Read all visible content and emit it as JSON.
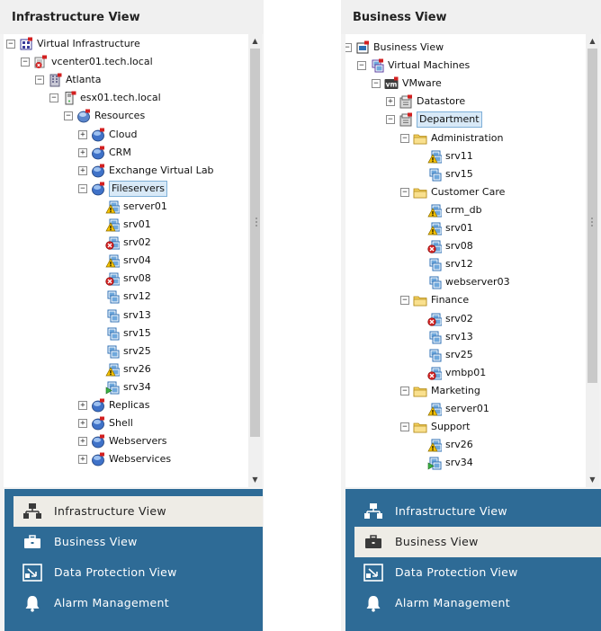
{
  "left": {
    "title": "Infrastructure View",
    "tree": [
      {
        "d": 0,
        "e": "-",
        "i": "vi-icon",
        "l": "Virtual Infrastructure"
      },
      {
        "d": 1,
        "e": "-",
        "i": "vcenter-icon",
        "l": "vcenter01.tech.local"
      },
      {
        "d": 2,
        "e": "-",
        "i": "datacenter-icon",
        "l": "Atlanta"
      },
      {
        "d": 3,
        "e": "-",
        "i": "host-icon",
        "l": "esx01.tech.local"
      },
      {
        "d": 4,
        "e": "-",
        "i": "resources-icon",
        "l": "Resources"
      },
      {
        "d": 5,
        "e": "+",
        "i": "pool-icon",
        "l": "Cloud"
      },
      {
        "d": 5,
        "e": "+",
        "i": "pool-icon",
        "l": "CRM"
      },
      {
        "d": 5,
        "e": "+",
        "i": "pool-icon",
        "l": "Exchange Virtual Lab"
      },
      {
        "d": 5,
        "e": "-",
        "i": "pool-icon",
        "l": "Fileservers",
        "sel": true
      },
      {
        "d": 6,
        "e": "",
        "i": "vm-warning-icon",
        "l": "server01"
      },
      {
        "d": 6,
        "e": "",
        "i": "vm-warning-icon",
        "l": "srv01"
      },
      {
        "d": 6,
        "e": "",
        "i": "vm-error-icon",
        "l": "srv02"
      },
      {
        "d": 6,
        "e": "",
        "i": "vm-warning-icon",
        "l": "srv04"
      },
      {
        "d": 6,
        "e": "",
        "i": "vm-error-icon",
        "l": "srv08"
      },
      {
        "d": 6,
        "e": "",
        "i": "vm-icon",
        "l": "srv12"
      },
      {
        "d": 6,
        "e": "",
        "i": "vm-icon",
        "l": "srv13"
      },
      {
        "d": 6,
        "e": "",
        "i": "vm-icon",
        "l": "srv15"
      },
      {
        "d": 6,
        "e": "",
        "i": "vm-icon",
        "l": "srv25"
      },
      {
        "d": 6,
        "e": "",
        "i": "vm-warning-icon",
        "l": "srv26"
      },
      {
        "d": 6,
        "e": "",
        "i": "vm-running-icon",
        "l": "srv34"
      },
      {
        "d": 5,
        "e": "+",
        "i": "pool-icon",
        "l": "Replicas"
      },
      {
        "d": 5,
        "e": "+",
        "i": "pool-icon",
        "l": "Shell"
      },
      {
        "d": 5,
        "e": "+",
        "i": "pool-icon",
        "l": "Webservers"
      },
      {
        "d": 5,
        "e": "+",
        "i": "pool-icon",
        "l": "Webservices"
      }
    ],
    "nav": [
      {
        "label": "Infrastructure View",
        "icon": "infrastructure-icon",
        "active": true
      },
      {
        "label": "Business View",
        "icon": "briefcase-icon",
        "active": false
      },
      {
        "label": "Data Protection View",
        "icon": "data-protection-icon",
        "active": false
      },
      {
        "label": "Alarm Management",
        "icon": "bell-icon",
        "active": false
      }
    ]
  },
  "right": {
    "title": "Business View",
    "tree": [
      {
        "d": 0,
        "e": "-",
        "i": "business-view-icon",
        "l": "Business View"
      },
      {
        "d": 1,
        "e": "-",
        "i": "vm-group-icon",
        "l": "Virtual Machines"
      },
      {
        "d": 2,
        "e": "-",
        "i": "vmware-icon",
        "l": "VMware"
      },
      {
        "d": 3,
        "e": "+",
        "i": "category-icon",
        "l": "Datastore"
      },
      {
        "d": 3,
        "e": "-",
        "i": "category-icon",
        "l": "Department",
        "sel": true
      },
      {
        "d": 4,
        "e": "-",
        "i": "folder-icon",
        "l": "Administration"
      },
      {
        "d": 5,
        "e": "",
        "i": "vm-warning-icon",
        "l": "srv11"
      },
      {
        "d": 5,
        "e": "",
        "i": "vm-icon",
        "l": "srv15"
      },
      {
        "d": 4,
        "e": "-",
        "i": "folder-icon",
        "l": "Customer Care"
      },
      {
        "d": 5,
        "e": "",
        "i": "vm-warning-icon",
        "l": "crm_db"
      },
      {
        "d": 5,
        "e": "",
        "i": "vm-warning-icon",
        "l": "srv01"
      },
      {
        "d": 5,
        "e": "",
        "i": "vm-error-icon",
        "l": "srv08"
      },
      {
        "d": 5,
        "e": "",
        "i": "vm-icon",
        "l": "srv12"
      },
      {
        "d": 5,
        "e": "",
        "i": "vm-icon",
        "l": "webserver03"
      },
      {
        "d": 4,
        "e": "-",
        "i": "folder-icon",
        "l": "Finance"
      },
      {
        "d": 5,
        "e": "",
        "i": "vm-error-icon",
        "l": "srv02"
      },
      {
        "d": 5,
        "e": "",
        "i": "vm-icon",
        "l": "srv13"
      },
      {
        "d": 5,
        "e": "",
        "i": "vm-icon",
        "l": "srv25"
      },
      {
        "d": 5,
        "e": "",
        "i": "vm-error-icon",
        "l": "vmbp01"
      },
      {
        "d": 4,
        "e": "-",
        "i": "folder-icon",
        "l": "Marketing"
      },
      {
        "d": 5,
        "e": "",
        "i": "vm-warning-icon",
        "l": "server01"
      },
      {
        "d": 4,
        "e": "-",
        "i": "folder-icon",
        "l": "Support"
      },
      {
        "d": 5,
        "e": "",
        "i": "vm-warning-icon",
        "l": "srv26"
      },
      {
        "d": 5,
        "e": "",
        "i": "vm-running-icon",
        "l": "srv34"
      }
    ],
    "nav": [
      {
        "label": "Infrastructure View",
        "icon": "infrastructure-icon",
        "active": false
      },
      {
        "label": "Business View",
        "icon": "briefcase-icon",
        "active": true
      },
      {
        "label": "Data Protection View",
        "icon": "data-protection-icon",
        "active": false
      },
      {
        "label": "Alarm Management",
        "icon": "bell-icon",
        "active": false
      }
    ]
  },
  "colors": {
    "nav_bg": "#2e6b96",
    "nav_active_bg": "#eeece6",
    "selection": "#d8e9f7"
  }
}
